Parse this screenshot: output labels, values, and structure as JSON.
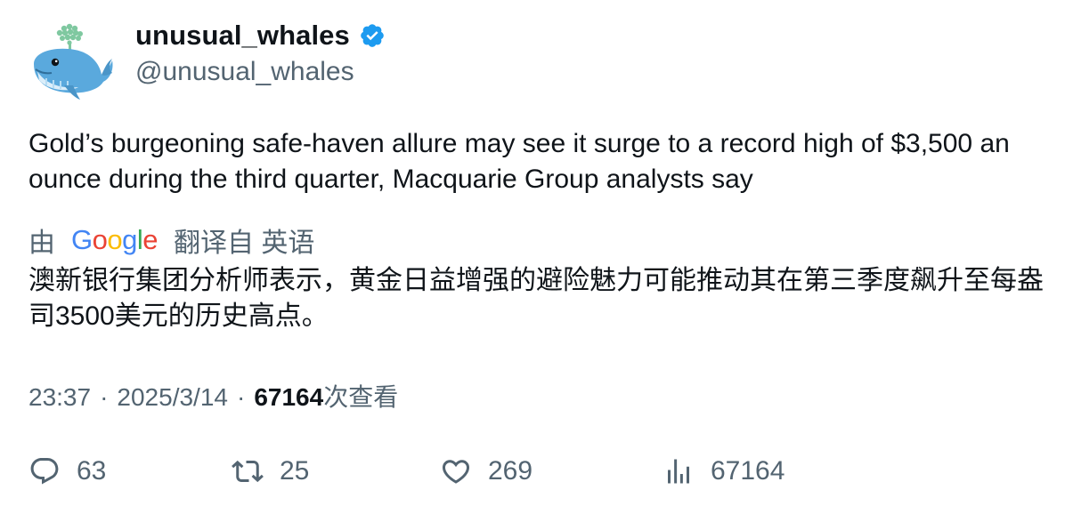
{
  "author": {
    "display_name": "unusual_whales",
    "handle": "@unusual_whales",
    "verified": true,
    "avatar_icon": "whale-avatar-icon"
  },
  "tweet": {
    "text": "Gold’s burgeoning safe-haven allure may see it surge to a record high of $3,500 an ounce during the third quarter, Macquarie Group analysts say"
  },
  "translation": {
    "prefix": "由",
    "provider_letters": [
      "G",
      "o",
      "o",
      "g",
      "l",
      "e"
    ],
    "provider_colors": [
      "#4285F4",
      "#EA4335",
      "#FBBC05",
      "#4285F4",
      "#34A853",
      "#EA4335"
    ],
    "suffix": "翻译自 英语",
    "text": "澳新银行集团分析师表示，黄金日益增强的避险魅力可能推动其在第三季度飙升至每盎司3500美元的历史高点。"
  },
  "meta": {
    "time": "23:37",
    "separator": "·",
    "date": "2025/3/14",
    "views_count": "67164",
    "views_label": "次查看"
  },
  "actions": {
    "replies": "63",
    "retweets": "25",
    "likes": "269",
    "views": "67164"
  },
  "colors": {
    "text_primary": "#0f1419",
    "text_secondary": "#536471",
    "verified_blue": "#1d9bf0"
  }
}
